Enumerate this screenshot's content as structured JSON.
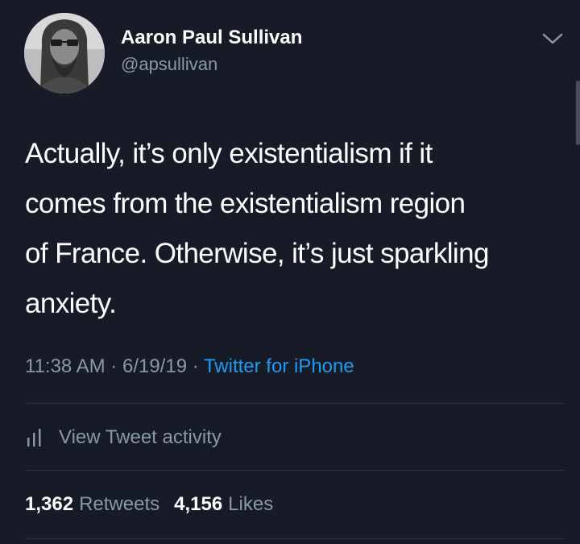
{
  "author": {
    "display_name": "Aaron Paul Sullivan",
    "handle": "@apsullivan"
  },
  "tweet": {
    "lines": [
      "Actually, it’s only existentialism if it",
      "comes from the existentialism region",
      "of France. Otherwise, it’s just sparkling",
      "anxiety."
    ],
    "time": "11:38 AM",
    "separator": "·",
    "date": "6/19/19",
    "source": "Twitter for iPhone"
  },
  "activity": {
    "label": "View Tweet activity",
    "icon": "bar-chart-icon"
  },
  "stats": {
    "retweets_count": "1,362",
    "retweets_label": "Retweets",
    "likes_count": "4,156",
    "likes_label": "Likes"
  },
  "colors": {
    "background": "#161b27",
    "primary_text": "#ffffff",
    "secondary_text": "#8899a6",
    "link": "#1d9bf0",
    "divider": "#2f3540"
  },
  "icons": {
    "menu": "chevron-down-icon",
    "avatar": "avatar"
  }
}
